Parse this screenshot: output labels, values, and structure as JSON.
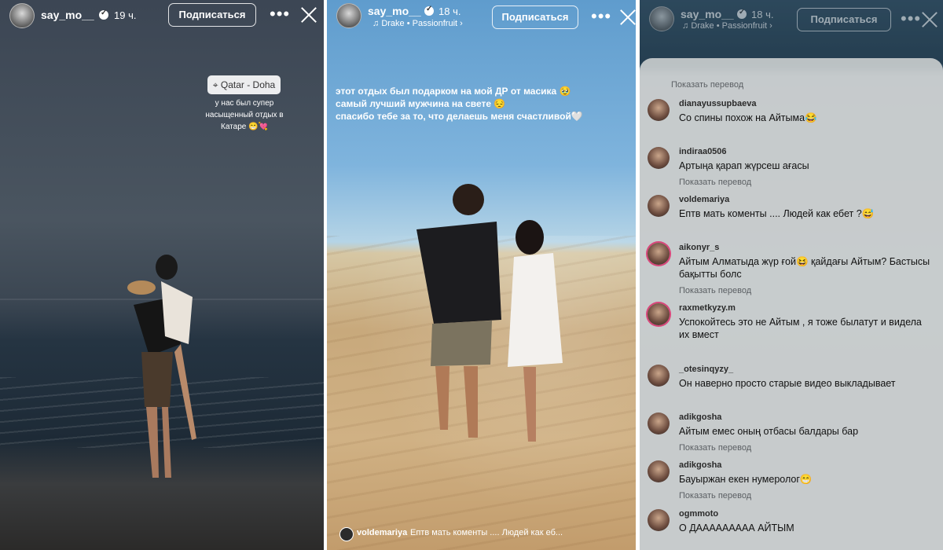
{
  "panel1": {
    "username": "say_mo__",
    "time": "19 ч.",
    "follow_label": "Подписаться",
    "more": "•••",
    "location": "Qatar - Doha",
    "caption": "у нас был супер насыщенный отдых в Катаре 😁💘"
  },
  "panel2": {
    "username": "say_mo__",
    "time": "18 ч.",
    "follow_label": "Подписаться",
    "more": "•••",
    "music": "Drake • Passionfruit ›",
    "caption_lines": [
      "этот отдых был подарком на мой ДР от масика 🥹",
      "самый лучший мужчина на свете 😔",
      "спасибо тебе за то, что делаешь меня счастливой🤍"
    ],
    "reply": {
      "username": "voldemariya",
      "text": "Eптв мать коменты .... Людей как еб..."
    }
  },
  "panel3": {
    "username": "say_mo__",
    "time": "18 ч.",
    "follow_label": "Подписаться",
    "more": "•••",
    "music": "Drake • Passionfruit ›",
    "translate_label": "Показать перевод",
    "comments": [
      {
        "username": "dianayussupbaeva",
        "text": "Со спины похож на Айтыма😂"
      },
      {
        "username": "indiraa0506",
        "text": "Артыңа қарап жүрсеш ағасы"
      },
      {
        "username": "voldemariya",
        "text": "Eптв мать коменты .... Людей как ебет ?😅"
      },
      {
        "username": "aikonyr_s",
        "text": "Айтым Алматыда жүр ғой😆 қайдағы Айтым? Бастысы бақытты болс"
      },
      {
        "username": "raxmetkyzy.m",
        "text": "Успокойтесь это не Айтым , я тоже былатут и видела их вмест"
      },
      {
        "username": "_otesinqyzy_",
        "text": "Он наверно просто старые видео выкладывает"
      },
      {
        "username": "adikgosha",
        "text": "Айтым емес оның отбасы балдары бар"
      },
      {
        "username": "adikgosha",
        "text": "Бауыржан екен нумеролог😁"
      },
      {
        "username": "ogmmoto",
        "text": "О ДААААААААА АЙТЫМ"
      }
    ]
  }
}
